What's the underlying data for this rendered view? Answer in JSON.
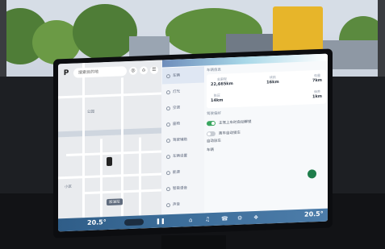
{
  "map": {
    "logo": "P",
    "search_placeholder": "搜索目的地",
    "btn_a": "◎",
    "btn_b": "⌂",
    "btn_c": "☰",
    "poi_1": "公园",
    "poi_2": "小区",
    "place_badge": "加油站"
  },
  "settings": {
    "menu": [
      {
        "label": "车辆",
        "icon": "car-icon"
      },
      {
        "label": "灯光",
        "icon": "light-icon"
      },
      {
        "label": "空调",
        "icon": "fan-icon"
      },
      {
        "label": "座椅",
        "icon": "seat-icon"
      },
      {
        "label": "驾驶辅助",
        "icon": "assist-icon"
      },
      {
        "label": "车辆设置",
        "icon": "gear-icon"
      },
      {
        "label": "能源",
        "icon": "battery-icon"
      },
      {
        "label": "智能语音",
        "icon": "voice-icon"
      },
      {
        "label": "声音",
        "icon": "sound-icon"
      }
    ],
    "section_1_title": "车辆信息",
    "card_1": {
      "stats": [
        {
          "label": "总里程",
          "value": "22,665km"
        },
        {
          "label": "续航",
          "value": "16km"
        },
        {
          "label": "电量",
          "value": "7km"
        }
      ],
      "stats_row2": [
        {
          "label": "胎压",
          "value": "14km"
        },
        {
          "label": "保养",
          "value": "1km"
        }
      ]
    },
    "section_2_title": "驾驶偏好",
    "toggles": [
      {
        "label": "主驾上车时自动解锁",
        "on": true
      },
      {
        "label": "离车自动锁车",
        "on": false
      }
    ],
    "text_1": "自动驻车",
    "text_2": "车辆"
  },
  "dock": {
    "temp_left": "20.5°",
    "temp_right": "20.5°",
    "pause": "❚❚",
    "icons": [
      "⌂",
      "♫",
      "☎",
      "⚙",
      "❖"
    ]
  },
  "colors": {
    "accent_green": "#3aa660",
    "dock_blue": "#2f5d88"
  }
}
